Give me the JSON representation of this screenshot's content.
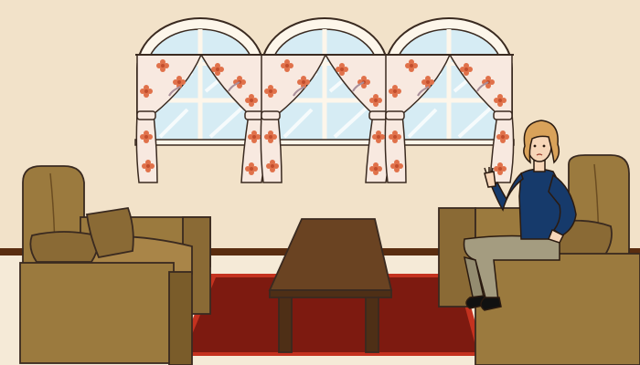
{
  "scene": {
    "type": "cartoon-living-room",
    "colors": {
      "wall": "#f2e2c9",
      "baseboard": "#5a2d10",
      "floor": "#f5ead7",
      "rug": "#7d1a10",
      "rug_border": "#c4321f",
      "sofa": "#9b7a3e",
      "sofa_dark": "#7a5c2a",
      "table": "#6a4322",
      "window_glass": "#d6ecf4",
      "curtain": "#f8e9e0",
      "curtain_flower": "#e0714a",
      "sweater": "#163a6b",
      "pants": "#a49c80",
      "hair": "#d9a25a"
    },
    "objects": [
      "window",
      "window",
      "window",
      "sofa-left",
      "sofa-right",
      "coffee-table",
      "rug",
      "woman-character"
    ]
  }
}
